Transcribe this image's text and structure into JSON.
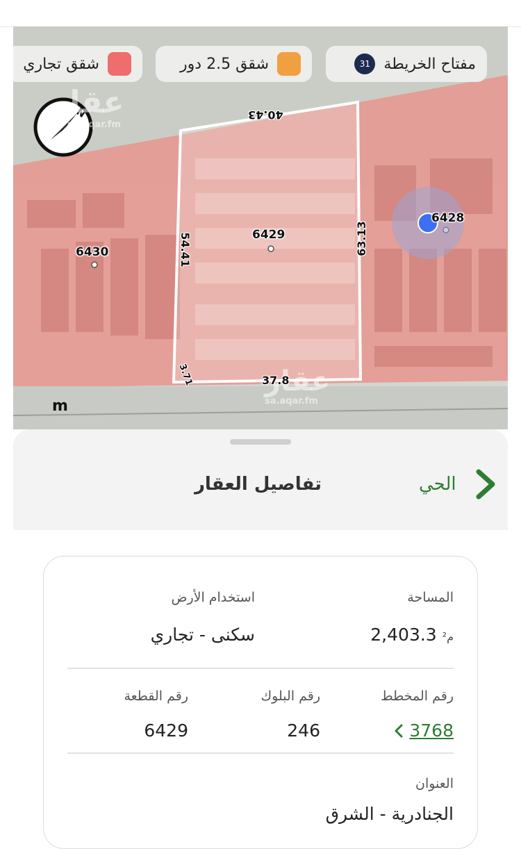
{
  "map": {
    "legend": {
      "title": "مفتاح الخريطة",
      "badge": "31",
      "items": [
        {
          "label": "شقق 2.5 دور",
          "color": "#f0a040"
        },
        {
          "label": "شقق تجاري",
          "color": "#ef6d6d"
        }
      ]
    },
    "parcels": {
      "main": "6429",
      "left": "6430",
      "right": "6428"
    },
    "dimensions": {
      "top": "40.43",
      "left": "54.41",
      "right": "63.13",
      "bottom": "37.8",
      "corner": "3.71"
    },
    "scale_unit": "m",
    "watermark_brand": "عقار",
    "watermark_url_1": "sa.aqar.fm",
    "watermark_url_2": "sa.aqar.fm"
  },
  "sheet": {
    "title": "تفاصيل العقار",
    "nav_link": "الحي"
  },
  "details": {
    "area_label": "المساحة",
    "area_value": "2,403.3",
    "area_unit": "م²",
    "land_use_label": "استخدام الأرض",
    "land_use_value": "سكنى - تجاري",
    "plan_label": "رقم المخطط",
    "plan_value": "3768",
    "block_label": "رقم البلوك",
    "block_value": "246",
    "plot_label": "رقم القطعة",
    "plot_value": "6429",
    "address_label": "العنوان",
    "address_value": "الجنادرية - الشرق"
  },
  "colors": {
    "accent": "#2e7d32",
    "commercial_zone": "#ef6d6d",
    "apartments_zone": "#f0a040"
  }
}
